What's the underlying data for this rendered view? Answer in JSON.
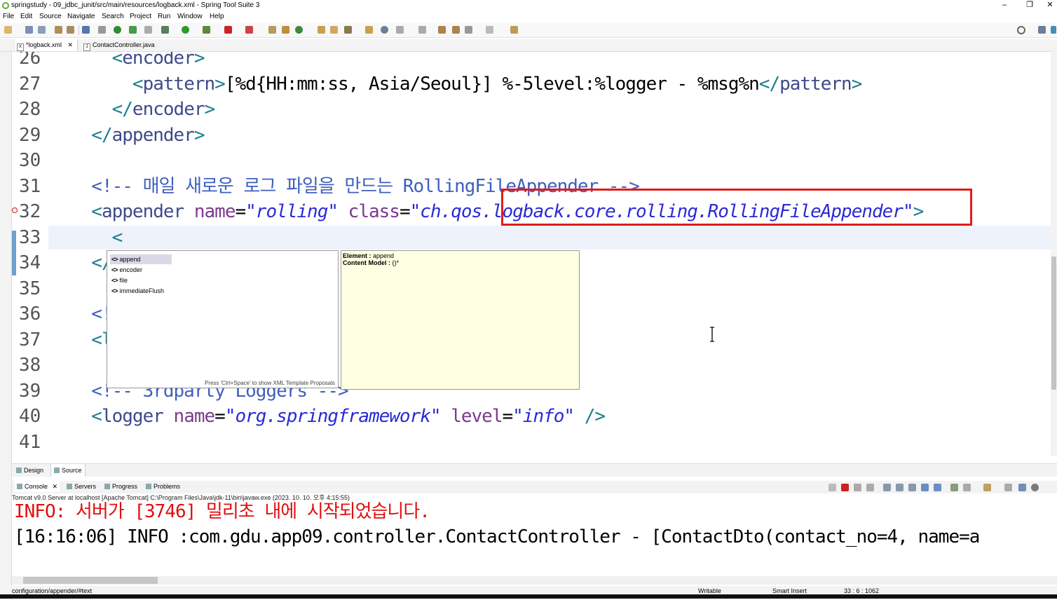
{
  "window": {
    "title": "springstudy - 09_jdbc_junit/src/main/resources/logback.xml - Spring Tool Suite 3",
    "minimize": "–",
    "restore": "❐",
    "close": "✕"
  },
  "menu": [
    "File",
    "Edit",
    "Source",
    "Navigate",
    "Search",
    "Project",
    "Run",
    "Window",
    "Help"
  ],
  "editor_tabs": [
    {
      "label": "*logback.xml",
      "close": "✕"
    },
    {
      "label": "ContactController.java"
    }
  ],
  "editor": {
    "lines": [
      {
        "n": "26",
        "parts": [
          [
            "tag",
            "    <"
          ],
          [
            "el",
            "encoder"
          ],
          [
            "tag",
            ">"
          ]
        ]
      },
      {
        "n": "27",
        "parts": [
          [
            "tag",
            "      <"
          ],
          [
            "el",
            "pattern"
          ],
          [
            "tag",
            ">"
          ],
          [
            "txt",
            "[%d{HH:mm:ss, Asia/Seoul}] %-5level:%logger - %msg%n"
          ],
          [
            "tag",
            "</"
          ],
          [
            "el",
            "pattern"
          ],
          [
            "tag",
            ">"
          ]
        ]
      },
      {
        "n": "28",
        "parts": [
          [
            "tag",
            "    </"
          ],
          [
            "el",
            "encoder"
          ],
          [
            "tag",
            ">"
          ]
        ]
      },
      {
        "n": "29",
        "parts": [
          [
            "tag",
            "  </"
          ],
          [
            "el",
            "appender"
          ],
          [
            "tag",
            ">"
          ]
        ]
      },
      {
        "n": "30",
        "parts": []
      },
      {
        "n": "31",
        "parts": [
          [
            "cmt",
            "  <!-- 매일 새로운 로그 파일을 만드는 RollingFileAppender -->"
          ]
        ]
      },
      {
        "n": "32",
        "parts": [
          [
            "tag",
            "  <"
          ],
          [
            "el",
            "appender"
          ],
          [
            "attr",
            " name"
          ],
          [
            "txt",
            "="
          ],
          [
            "val",
            "\"rolling\""
          ],
          [
            "attr",
            " class"
          ],
          [
            "txt",
            "="
          ],
          [
            "val",
            "\"ch.qos.logback.core.rolling.RollingFileAppender\""
          ],
          [
            "tag",
            ">"
          ]
        ]
      },
      {
        "n": "33",
        "parts": [
          [
            "tag",
            "    <"
          ]
        ]
      },
      {
        "n": "34",
        "parts": [
          [
            "tag",
            "  </ap"
          ]
        ]
      },
      {
        "n": "35",
        "parts": []
      },
      {
        "n": "36",
        "parts": [
          [
            "cmt",
            "  <!--"
          ]
        ]
      },
      {
        "n": "37",
        "parts": [
          [
            "tag",
            "  <lo"
          ]
        ]
      },
      {
        "n": "38",
        "parts": []
      },
      {
        "n": "39",
        "parts": [
          [
            "cmt",
            "  <!-- 3rdparty Loggers -->"
          ]
        ]
      },
      {
        "n": "40",
        "parts": [
          [
            "tag",
            "  <"
          ],
          [
            "el",
            "logger"
          ],
          [
            "attr",
            " name"
          ],
          [
            "txt",
            "="
          ],
          [
            "val",
            "\"org.springframework\""
          ],
          [
            "attr",
            " level"
          ],
          [
            "txt",
            "="
          ],
          [
            "val",
            "\"info\""
          ],
          [
            "tag",
            " />"
          ]
        ]
      },
      {
        "n": "41",
        "parts": []
      }
    ]
  },
  "content_assist": {
    "proposals": [
      "append",
      "encoder",
      "file",
      "immediateFlush"
    ],
    "selected": "append",
    "hint": "Press 'Ctrl+Space' to show XML Template Proposals"
  },
  "doc_popup": {
    "element_label": "Element :",
    "element_value": "append",
    "content_model_label": "Content Model :",
    "content_model_value": "()*"
  },
  "page_tabs": [
    "Design",
    "Source"
  ],
  "views": [
    "Console",
    "Servers",
    "Progress",
    "Problems"
  ],
  "console": {
    "launch": "Tomcat v9.0 Server at localhost [Apache Tomcat] C:\\Program Files\\Java\\jdk-11\\bin\\javaw.exe  (2023. 10. 10. 오후 4:15:55)",
    "lines": [
      {
        "text": "INFO: 서버가 [3746] 밀리초 내에 시작되었습니다.",
        "color": "#e01010"
      },
      {
        "text": "[16:16:06] INFO :com.gdu.app09.controller.ContactController - [ContactDto(contact_no=4, name=a",
        "color": "#000000"
      }
    ]
  },
  "status": {
    "path": "configuration/appender/#text",
    "writable": "Writable",
    "insert": "Smart Insert",
    "position": "33 : 6 : 1062"
  },
  "colors": {
    "highlight_box": "#e21b1b"
  }
}
